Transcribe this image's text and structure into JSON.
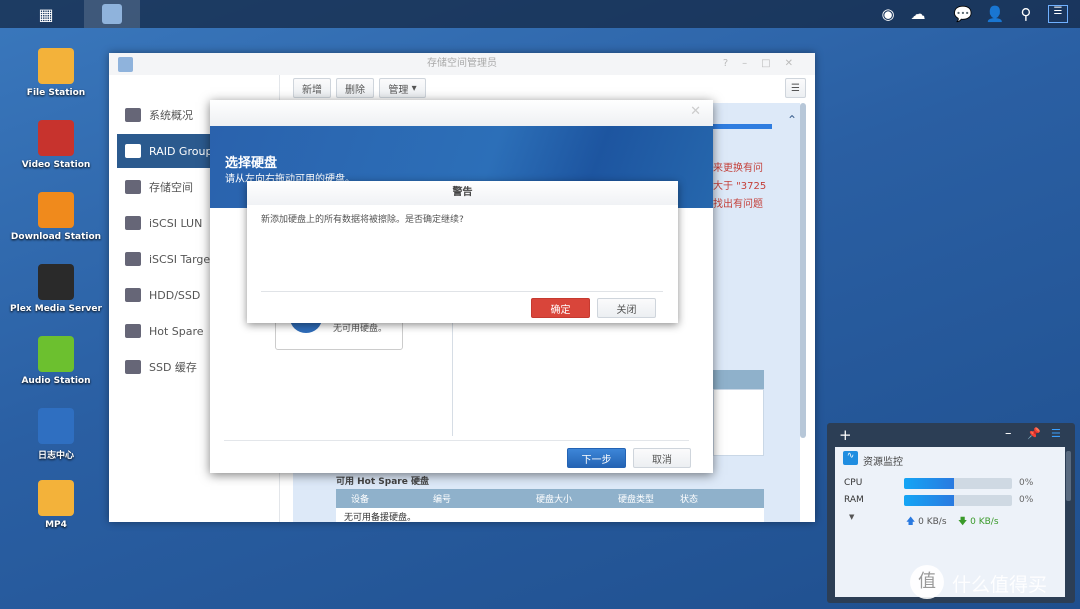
{
  "taskbar": {
    "icons": [
      "main-menu-icon",
      "storage-manager-icon"
    ],
    "tray": [
      "notification-status-icon",
      "cloud-sync-icon",
      "chat-icon",
      "user-icon",
      "search-icon",
      "widgets-icon"
    ]
  },
  "desktop": [
    {
      "label": "File Station",
      "color": "#f3b23a"
    },
    {
      "label": "Video Station",
      "color": "#c7332d"
    },
    {
      "label": "Download Station",
      "color": "#f08a1c"
    },
    {
      "label": "Plex Media Server",
      "color": "#2a2a2a"
    },
    {
      "label": "Audio Station",
      "color": "#6cc02f"
    },
    {
      "label": "日志中心",
      "color": "#2f6fc1"
    },
    {
      "label": "MP4",
      "color": "#f3b23a"
    }
  ],
  "window": {
    "title": "存储空间管理员",
    "sidebar": [
      {
        "label": "系统概况"
      },
      {
        "label": "RAID Group"
      },
      {
        "label": "存储空间"
      },
      {
        "label": "iSCSI LUN"
      },
      {
        "label": "iSCSI Target"
      },
      {
        "label": "HDD/SSD"
      },
      {
        "label": "Hot Spare"
      },
      {
        "label": "SSD 缓存"
      }
    ],
    "toolbar": {
      "add": "新增",
      "delete": "删除",
      "manage": "管理"
    },
    "content": {
      "partial_text": "3",
      "red_lines": [
        "来更换有问",
        "大于 \"3725",
        "找出有问题"
      ],
      "hotspare_title": "可用 Hot Spare 硬盘",
      "columns": [
        "设备",
        "编号",
        "硬盘大小",
        "硬盘类型",
        "状态"
      ],
      "empty": "无可用备援硬盘。"
    }
  },
  "wizard": {
    "title": "选择硬盘",
    "subtitle": "请从左向右拖动可用的硬盘。",
    "no_disk": "无可用硬盘。",
    "next": "下一步",
    "cancel": "取消"
  },
  "warning": {
    "title": "警告",
    "message": "新添加硬盘上的所有数据将被擦除。是否确定继续?",
    "ok": "确定",
    "close": "关闭"
  },
  "monitor": {
    "title": "资源监控",
    "cpu_label": "CPU",
    "cpu_value": "0%",
    "cpu_bar": 0.46,
    "ram_label": "RAM",
    "ram_value": "0%",
    "ram_bar": 0.46,
    "upload": "0 KB/s",
    "download": "0 KB/s"
  },
  "watermark": "什么值得买",
  "colors": {
    "accent": "#2b5a8e",
    "danger": "#d9453a",
    "primary": "#2f6fc1"
  }
}
